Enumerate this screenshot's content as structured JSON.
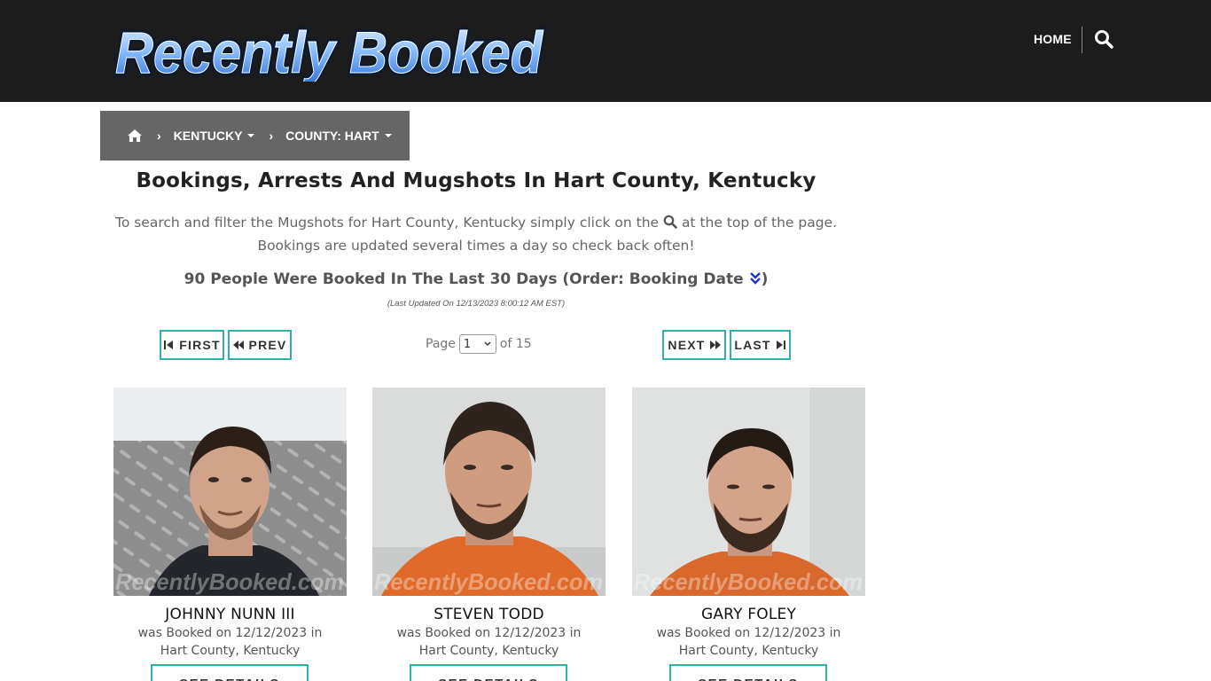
{
  "header": {
    "logo_text": "Recently Booked",
    "nav": {
      "home_label": "HOME"
    },
    "icons": {
      "search": "search-icon"
    }
  },
  "breadcrumb": {
    "home_icon": "home-icon",
    "items": [
      {
        "label": "KENTUCKY"
      },
      {
        "label": "COUNTY: HART"
      }
    ]
  },
  "page": {
    "title": "Bookings, Arrests And Mugshots In Hart County, Kentucky",
    "intro_part1": "To search and filter the Mugshots for Hart County, Kentucky simply click on the",
    "intro_part2": "at the top of the page.",
    "intro_line2": "Bookings are updated several times a day so check back often!",
    "count_text": "90 People Were Booked In The Last 30 Days (Order: Booking Date",
    "count_close": ")",
    "last_updated": "(Last Updated On 12/13/2023 8:00:12 AM EST)"
  },
  "pager": {
    "first_label": "FIRST",
    "prev_label": "PREV",
    "next_label": "NEXT",
    "last_label": "LAST",
    "page_label": "Page",
    "current_page": "1",
    "of_label": "of 15"
  },
  "cards": [
    {
      "name": "JOHNNY NUNN III",
      "booked_line1": "was Booked on 12/12/2023 in",
      "booked_line2": "Hart County, Kentucky",
      "watermark": "RecentlyBooked.com",
      "details_label": "SEE DETAILS"
    },
    {
      "name": "STEVEN TODD",
      "booked_line1": "was Booked on 12/12/2023 in",
      "booked_line2": "Hart County, Kentucky",
      "watermark": "RecentlyBooked.com",
      "details_label": "SEE DETAILS"
    },
    {
      "name": "GARY FOLEY",
      "booked_line1": "was Booked on 12/12/2023 in",
      "booked_line2": "Hart County, Kentucky",
      "watermark": "RecentlyBooked.com",
      "details_label": "SEE DETAILS"
    }
  ],
  "colors": {
    "header_bg": "#1c1c1c",
    "breadcrumb_bg": "#666666",
    "button_border": "#2bb3a8",
    "order_icon": "#1a35c8",
    "logo_blue": "#5c9cf0"
  }
}
